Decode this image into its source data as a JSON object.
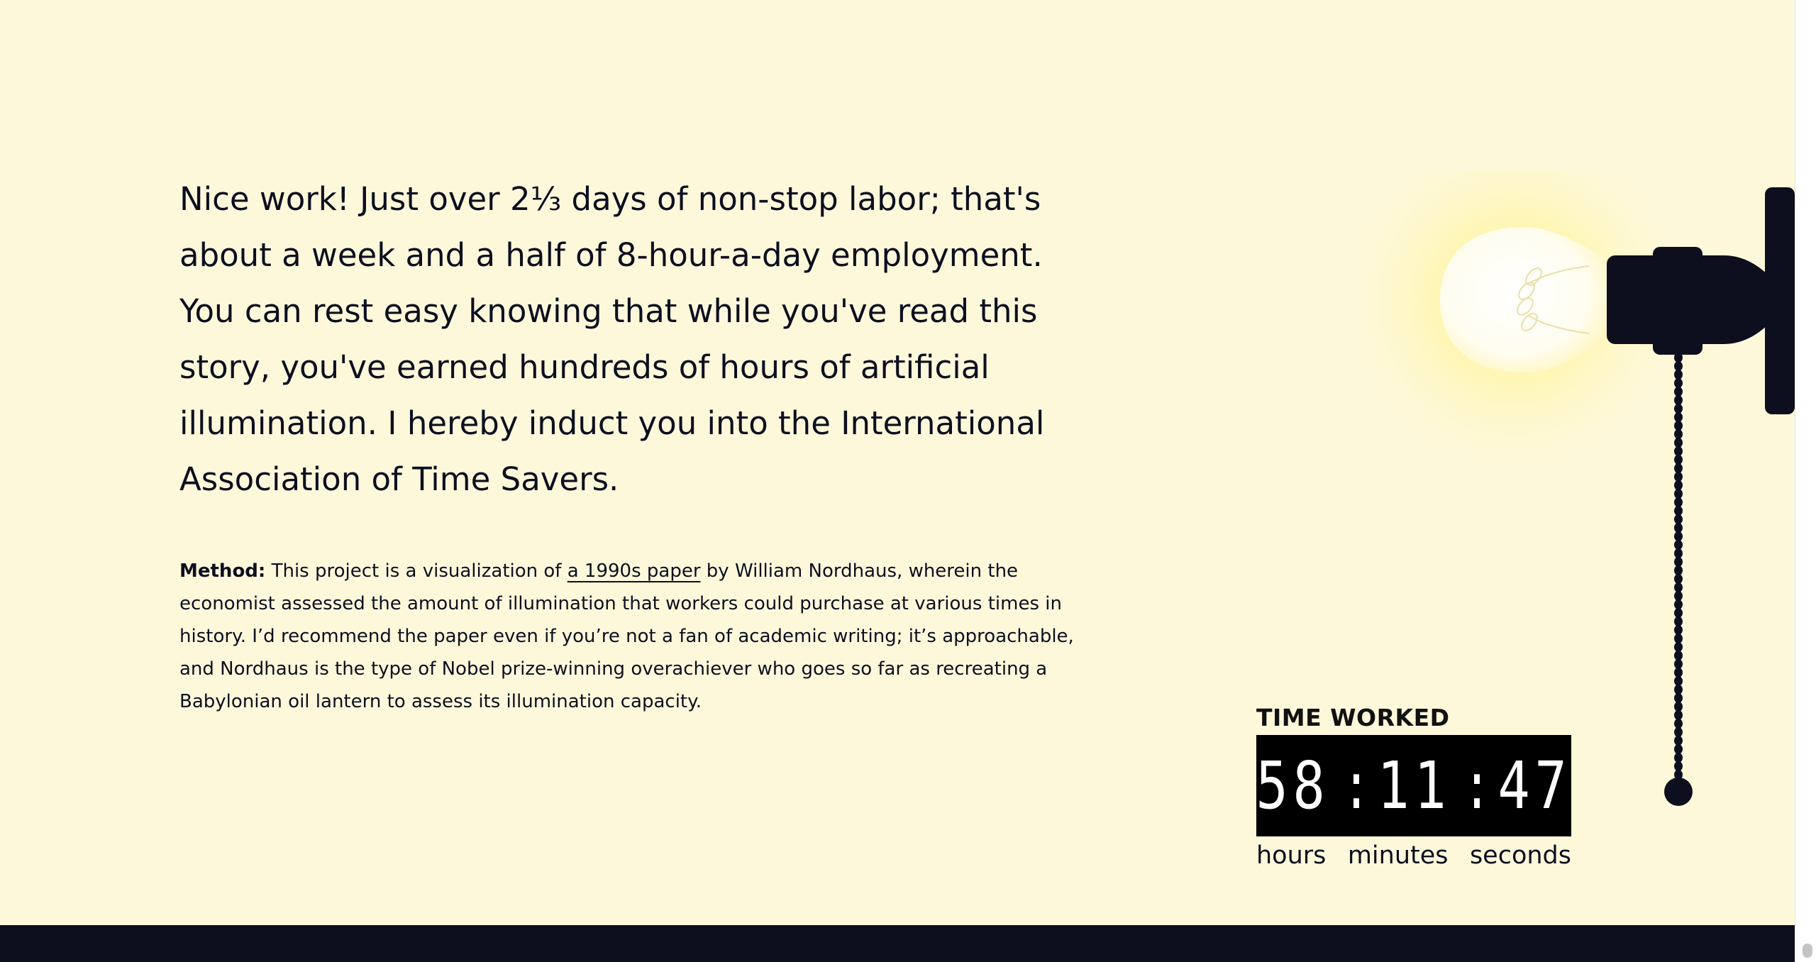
{
  "lead": "Nice work! Just over 2⅓ days of non-stop labor; that's about a week and a half of 8-hour-a-day employment. You can rest easy knowing that while you've read this story, you've earned hundreds of hours of artificial illumination. I hereby induct you into the International Association of Time Savers.",
  "method": {
    "label": "Method:",
    "text_before_link": "This project is a visualization of",
    "link_text": "a 1990s paper",
    "text_after_link": "by William Nordhaus, wherein the economist assessed the amount of illumination that workers could purchase at various times in history. I’d recommend the paper even if you’re not a fan of academic writing; it’s approachable, and Nordhaus is the type of Nobel prize-winning overachiever who goes so far as recreating a Babylonian oil lantern to assess its illumination capacity."
  },
  "timer": {
    "title": "TIME WORKED",
    "hours": "58",
    "minutes": "11",
    "seconds": "47",
    "separator": ":",
    "hours_label": "hours",
    "minutes_label": "minutes",
    "seconds_label": "seconds"
  },
  "icons": {
    "lamp": "light-bulb-icon",
    "pull_chain": "pull-chain-icon"
  },
  "colors": {
    "background": "#fef8db",
    "ink": "#0d0f1f",
    "clock_background": "#000000",
    "bulb_glow": "#fff8b0"
  }
}
